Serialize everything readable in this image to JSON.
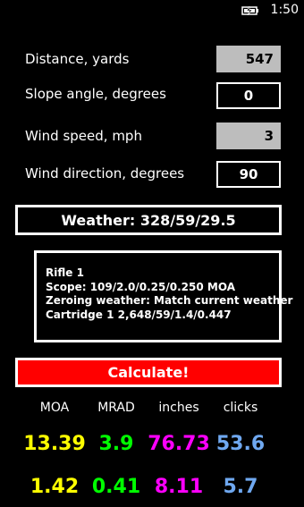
{
  "status_bar": {
    "icons": [
      "battery-charging-icon"
    ],
    "time": "1:50"
  },
  "inputs": {
    "distance": {
      "label": "Distance, yards",
      "value": "547"
    },
    "slope": {
      "label": "Slope angle, degrees",
      "value": "0"
    },
    "wind_speed": {
      "label": "Wind speed, mph",
      "value": "3"
    },
    "wind_direction": {
      "label": "Wind direction, degrees",
      "value": "90"
    }
  },
  "weather": {
    "label": "Weather: 328/59/29.5"
  },
  "profile": {
    "lines": [
      "Rifle 1",
      "Scope: 109/2.0/0.25/0.250 MOA",
      "Zeroing weather: Match current weather",
      "Cartridge 1 2,648/59/1.4/0.447"
    ]
  },
  "calculate_button": {
    "label": "Calculate!",
    "color": "#ff0000"
  },
  "results": {
    "headers": [
      "MOA",
      "MRAD",
      "inches",
      "clicks"
    ],
    "colors": [
      "#ffff00",
      "#00ff00",
      "#ff00ff",
      "#6fa8f0"
    ],
    "row1": [
      "13.39",
      "3.9",
      "76.73",
      "53.6"
    ],
    "row2": [
      "1.42",
      "0.41",
      "8.11",
      "5.7"
    ]
  }
}
